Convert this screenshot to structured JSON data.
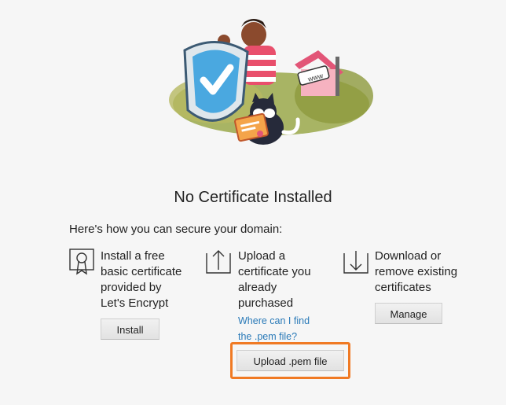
{
  "page": {
    "title": "No Certificate Installed",
    "subtitle": "Here's how you can secure your domain:"
  },
  "illustration": {
    "sign_text": "www"
  },
  "options": {
    "install": {
      "icon": "certificate-ribbon-icon",
      "text": "Install a free\nbasic certificate\nprovided by\nLet's Encrypt",
      "button_label": "Install"
    },
    "upload": {
      "icon": "upload-arrow-icon",
      "text": "Upload a\ncertificate you\nalready\npurchased",
      "link_text": "Where can I find the .pem file?",
      "button_label": "Upload .pem file"
    },
    "manage": {
      "icon": "download-arrow-icon",
      "text": "Download or\nremove existing\ncertificates",
      "button_label": "Manage"
    }
  },
  "colors": {
    "highlight": "#f07a24",
    "link": "#2a7ab8",
    "shield": "#4aa8e0"
  }
}
